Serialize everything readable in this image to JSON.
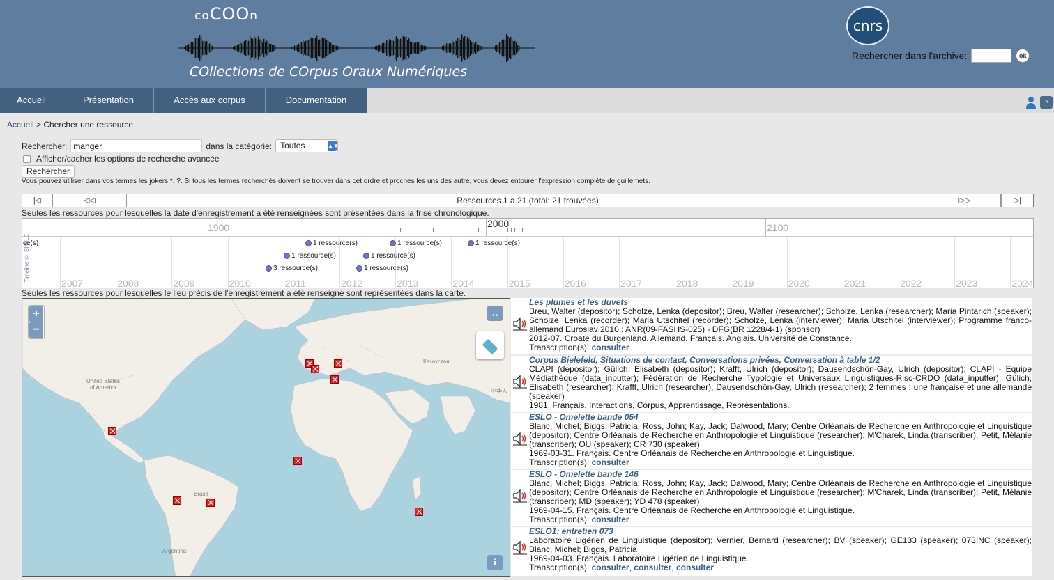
{
  "header": {
    "logo_word_prefix": "co",
    "logo_word_main": "COO",
    "logo_word_suffix": "n",
    "logo_subtitle": "COllections de COrpus Oraux Numériques",
    "partner_logo": "cnrs",
    "archive_search_label": "Rechercher dans l'archive:",
    "archive_search_value": "",
    "ok_label": "ok"
  },
  "nav": {
    "items": [
      {
        "label": "Accueil"
      },
      {
        "label": "Présentation"
      },
      {
        "label": "Accès aux corpus"
      },
      {
        "label": "Documentation"
      }
    ],
    "icons": [
      "user-icon",
      "rss-icon"
    ]
  },
  "breadcrumb": {
    "home": "Accueil",
    "separator": " > ",
    "current": "Chercher une ressource"
  },
  "search": {
    "label": "Rechercher:",
    "value": "manger",
    "category_label": "dans la catégorie:",
    "category_value": "Toutes",
    "advanced_label": "Afficher/cacher les options de recherche avancée",
    "button_label": "Rechercher",
    "hint": "Vous pouvez utiliser dans vos termes les jokers *, ?. Si tous les termes recherchés doivent se trouver dans cet ordre et proches les uns des autre, vous devez entourer l'expression complète de guillemets."
  },
  "pager": {
    "first": "|◁",
    "prev": "◁◁",
    "label": "Ressources 1 à 21 (total: 21 trouvées)",
    "next": "▷▷",
    "last": "▷|"
  },
  "timeline": {
    "note": "Seules les ressources pour lesquelles la date d'enregistrement a été renseignées sont présentées dans la frise chronologique.",
    "credit": "Timeline © SIMILE",
    "centuries": [
      "1900",
      "2000",
      "2100"
    ],
    "years": [
      "2007",
      "2008",
      "2009",
      "2010",
      "2011",
      "2012",
      "2013",
      "2014",
      "2015",
      "2016",
      "2017",
      "2018",
      "2019",
      "2020",
      "2021",
      "2022",
      "2023",
      "2024"
    ],
    "events": [
      {
        "label": "ce(s)"
      },
      {
        "label": "1 ressource(s)"
      },
      {
        "label": "1 ressource(s)"
      },
      {
        "label": "1 ressource(s)"
      },
      {
        "label": "1 ressource(s)"
      },
      {
        "label": "1 ressource(s)"
      },
      {
        "label": "3 ressource(s)"
      },
      {
        "label": "1 ressource(s)"
      }
    ]
  },
  "map": {
    "note": "Seules les ressources pour lesquelles le lieu précis de l'enregistrement a été renseigné sont représentées dans la carte.",
    "zoom_in": "+",
    "zoom_out": "−",
    "expand": "↔",
    "info": "i",
    "labels": {
      "usa": "United States\nof America",
      "kazakhstan": "Казахстан",
      "china": "中华人",
      "brasil": "Brasil",
      "argentina": "Argentina"
    }
  },
  "results": [
    {
      "title": "Les plumes et les duvets",
      "people": "Breu, Walter (depositor); Scholze, Lenka (depositor); Breu, Walter (researcher); Scholze, Lenka (researcher); Maria Pintarich (speaker); Scholze, Lenka (recorder); Maria Utschitel (recorder); Scholze, Lenka (interviewer); Maria Utschitel (interviewer); Programme franco-allemand Euroslav 2010 : ANR(09-FASHS-025) - DFG(BR 1228/4-1) (sponsor)",
      "meta": "2012-07. Croate du Burgenland. Allemand. Français. Anglais. Université de Constance.",
      "trans_label": "Transcription(s): ",
      "links": [
        "consulter"
      ]
    },
    {
      "title": "Corpus Bielefeld, Situations de contact, Conversations privées, Conversation à table 1/2",
      "people": "CLAPI (depositor); Gülich, Elisabeth (depositor); Krafft, Ulrich (depositor); Dausendschön-Gay, Ulrich (depositor); CLAPI - Equipe Médiathèque (data_inputter); Fédération de Recherche Typologie et Universaux Linguistiques-Risc-CRDO (data_inputter); Gülich, Elisabeth (researcher); Krafft, Ulrich (researcher); Dausendschön-Gay, Ulrich (researcher); 2 femmes : une française et une allemande (speaker)",
      "meta": "1981. Français. Interactions, Corpus, Apprentissage, Représentations.",
      "trans_label": "",
      "links": []
    },
    {
      "title": "ESLO - Omelette bande 054",
      "people": "Blanc, Michel; Biggs, Patricia; Ross, John; Kay, Jack; Dalwood, Mary; Centre Orléanais de Recherche en Anthropologie et Linguistique (depositor); Centre Orléanais de Recherche en Anthropologie et Linguistique (researcher); M'Charek, Linda (transcriber); Petit, Mélanie (transcriber); OU (speaker); CR 730 (speaker)",
      "meta": "1969-03-31. Français. Centre Orléanais de Recherche en Anthropologie et Linguistique.",
      "trans_label": "Transcription(s): ",
      "links": [
        "consulter"
      ]
    },
    {
      "title": "ESLO - Omelette bande 146",
      "people": "Blanc, Michel; Biggs, Patricia; Ross, John; Kay, Jack; Dalwood, Mary; Centre Orléanais de Recherche en Anthropologie et Linguistique (depositor); Centre Orléanais de Recherche en Anthropologie et Linguistique (researcher); M'Charek, Linda (transcriber); Petit, Mélanie (transcriber); MD (speaker); YD 478 (speaker)",
      "meta": "1969-04-15. Français. Centre Orléanais de Recherche en Anthropologie et Linguistique.",
      "trans_label": "Transcription(s): ",
      "links": [
        "consulter"
      ]
    },
    {
      "title": "ESLO1: entretien 073",
      "people": "Laboratoire Ligérien de Linguistique (depositor); Vernier, Bernard (researcher); BV (speaker); GE133 (speaker); 073INC (speaker); Blanc, Michel; Biggs, Patricia",
      "meta": "1969-04-03. Français. Laboratoire Ligérien de Linguistique.",
      "trans_label": "Transcription(s): ",
      "links": [
        "consulter",
        "consulter",
        "consulter"
      ]
    }
  ]
}
